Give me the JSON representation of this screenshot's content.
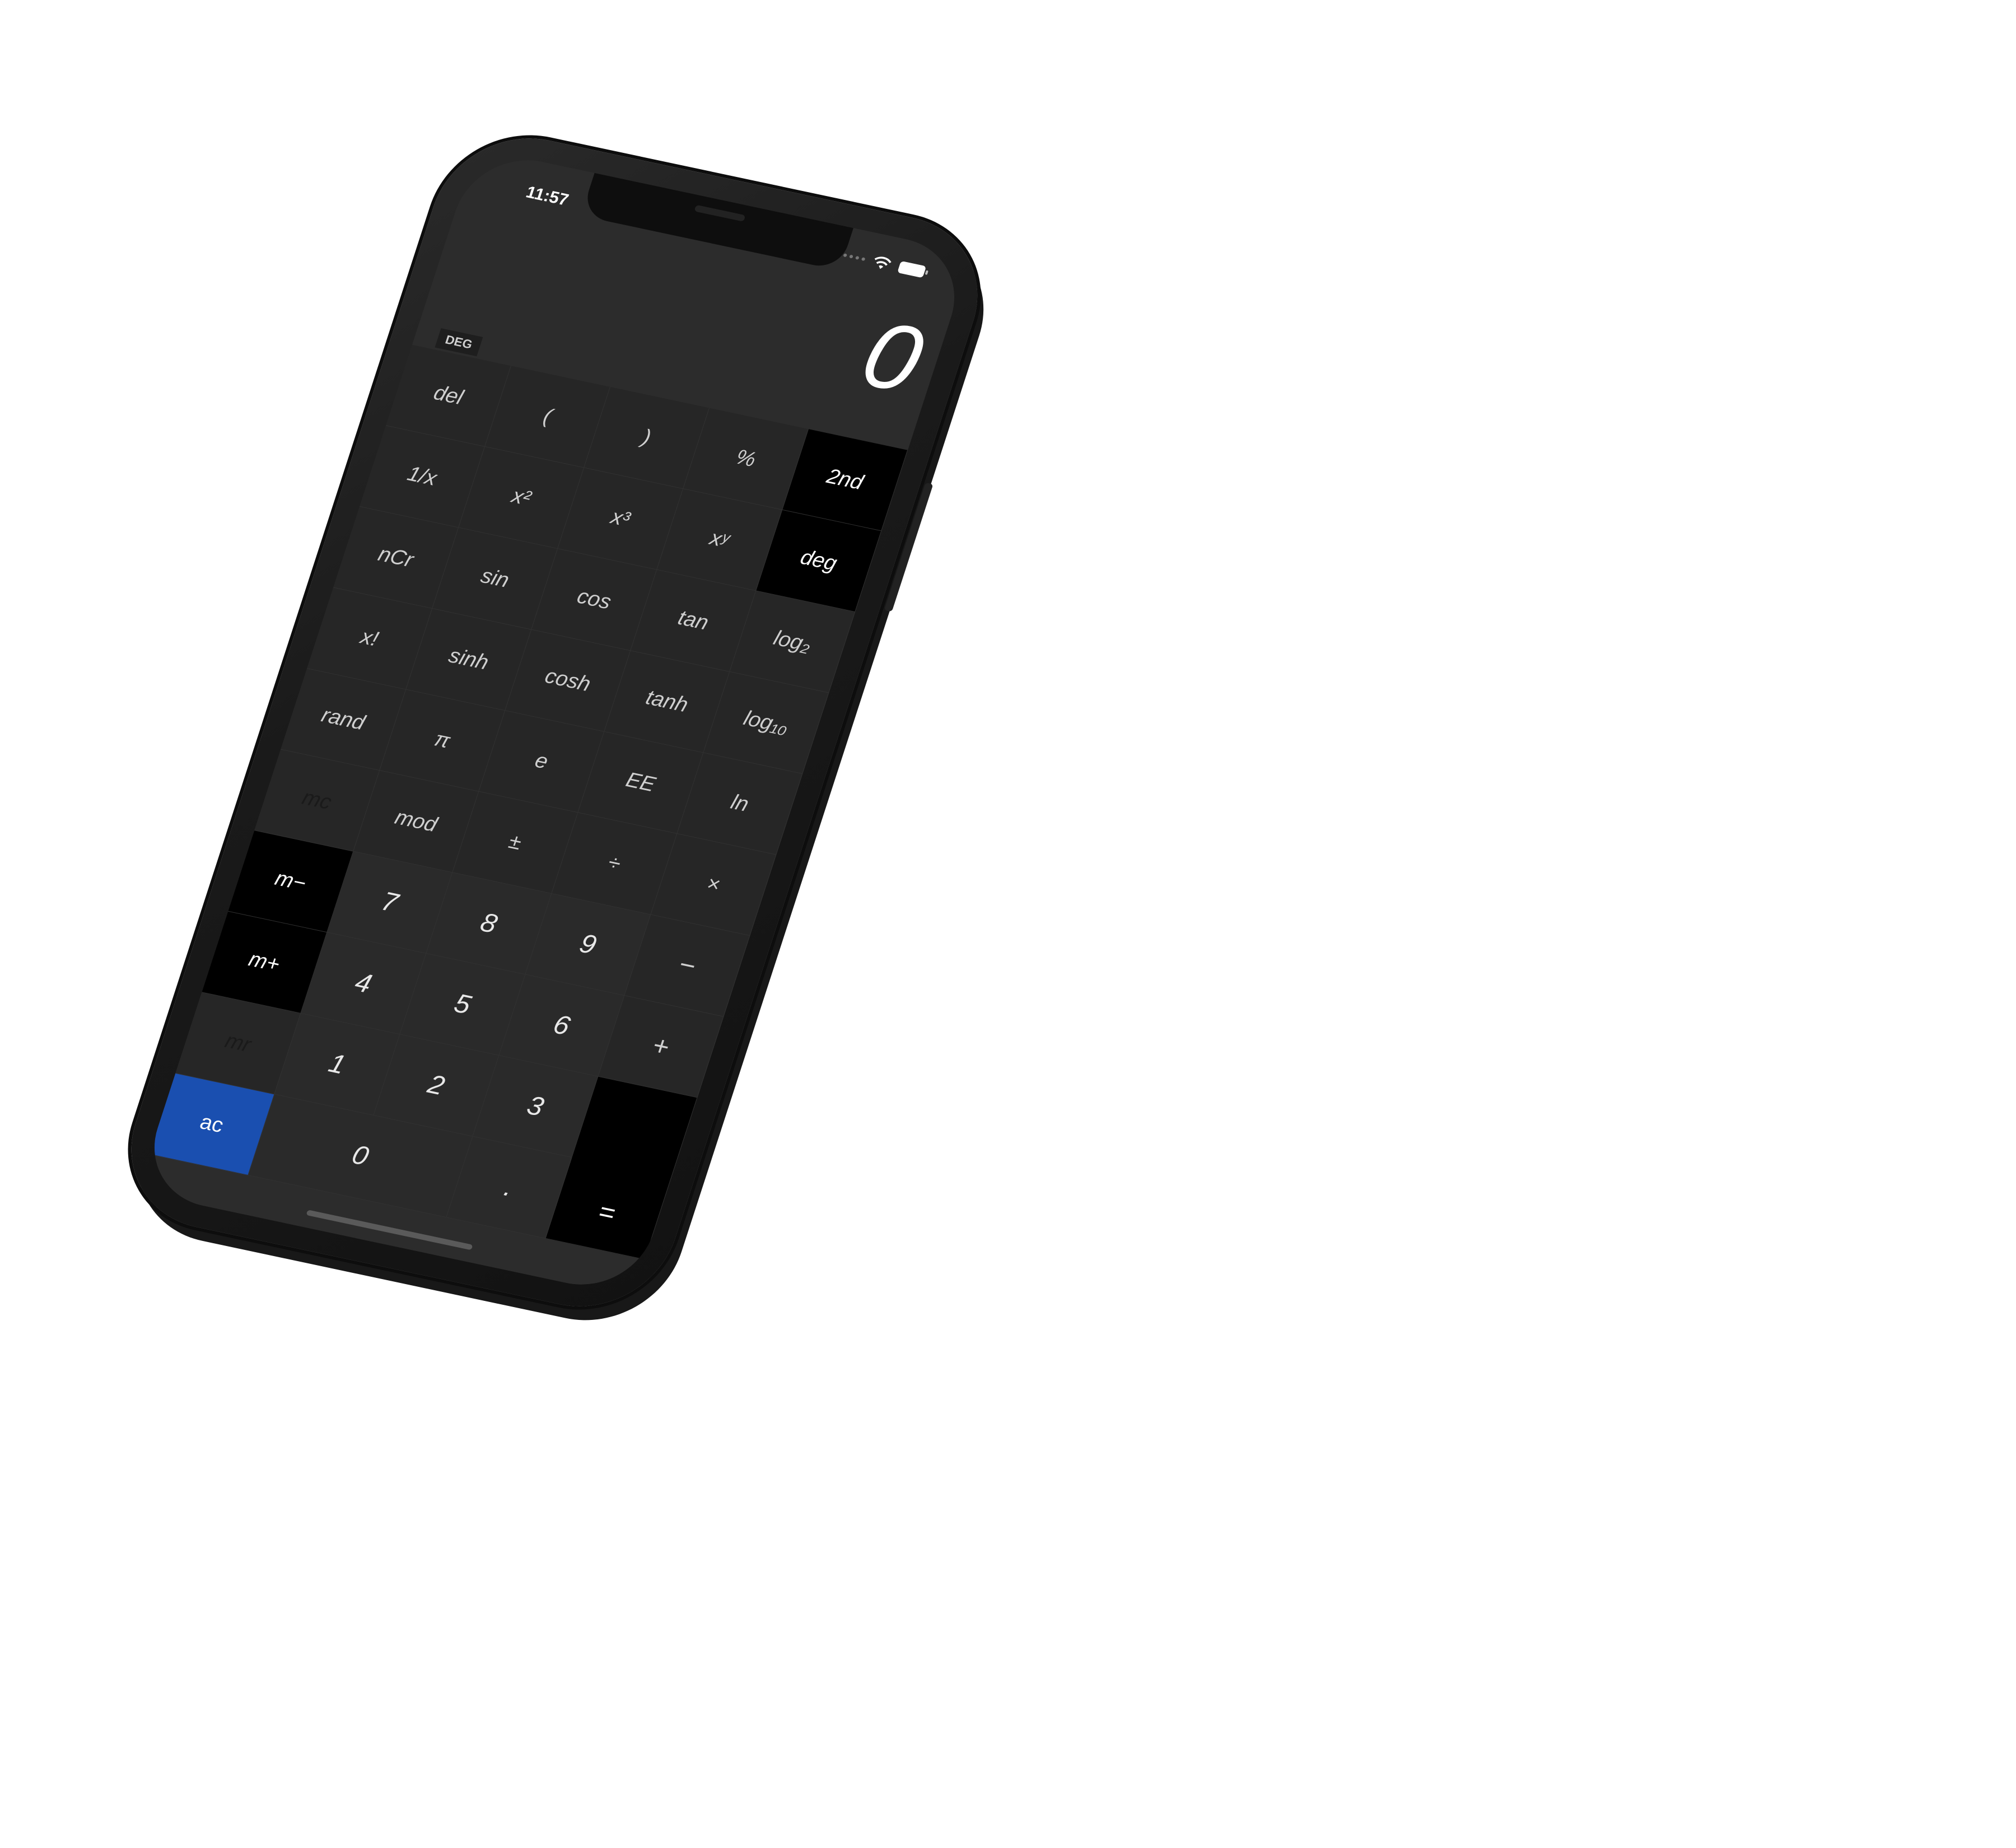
{
  "status_bar": {
    "time": "11:57"
  },
  "display": {
    "value": "0",
    "angle_mode": "DEG"
  },
  "keys": {
    "del": "del",
    "open_paren": "(",
    "close_paren": ")",
    "percent": "%",
    "second": "2nd",
    "reciprocal": "1/x",
    "square": "x²",
    "cube": "x³",
    "power": "xʸ",
    "deg": "deg",
    "ncr": "nCr",
    "sin": "sin",
    "cos": "cos",
    "tan": "tan",
    "log2": "log₂",
    "factorial": "x!",
    "sinh": "sinh",
    "cosh": "cosh",
    "tanh": "tanh",
    "log10": "log₁₀",
    "rand": "rand",
    "pi": "π",
    "e": "e",
    "ee": "EE",
    "ln": "ln",
    "mc": "mc",
    "mod": "mod",
    "plus_minus": "±",
    "divide": "÷",
    "multiply": "×",
    "m_minus": "m−",
    "seven": "7",
    "eight": "8",
    "nine": "9",
    "minus": "−",
    "m_plus": "m+",
    "four": "4",
    "five": "5",
    "six": "6",
    "plus": "+",
    "mr": "mr",
    "one": "1",
    "two": "2",
    "three": "3",
    "ac": "ac",
    "zero": "0",
    "decimal": ".",
    "equals": "="
  },
  "colors": {
    "screen_bg": "#2c2c2c",
    "key_bg": "#2a2a2a",
    "dark_key_bg": "#000000",
    "accent": "#1a4fb0"
  }
}
